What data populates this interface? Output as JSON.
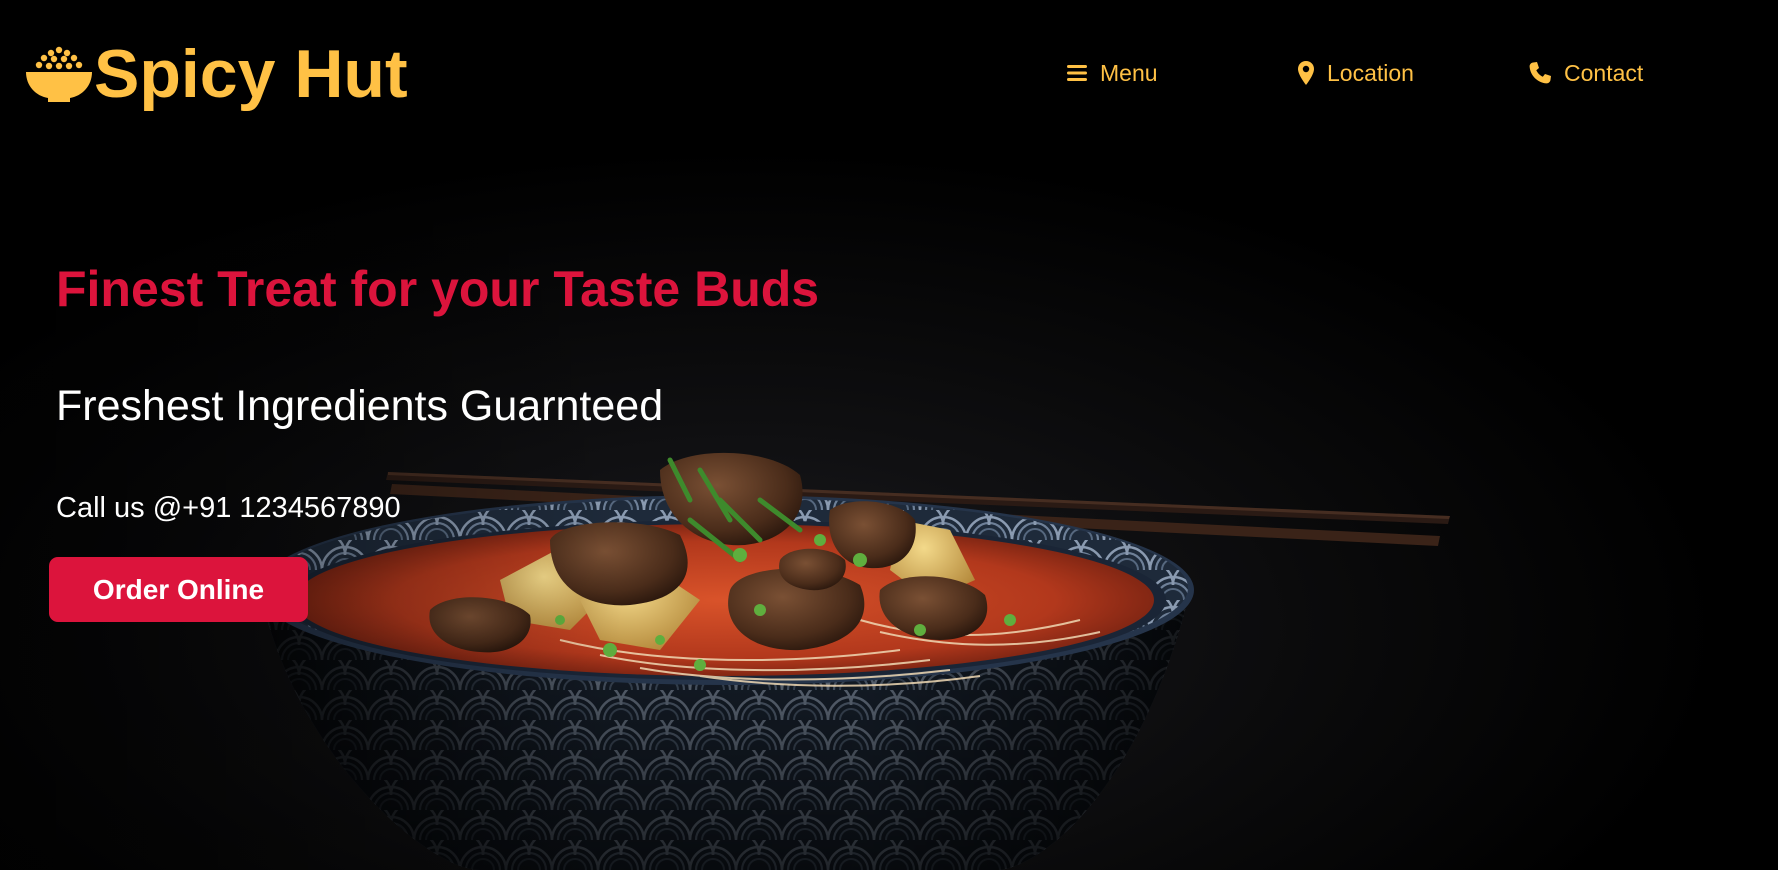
{
  "brand": {
    "name": "Spicy Hut",
    "icon": "rice-bowl-icon"
  },
  "nav": {
    "items": [
      {
        "label": "Menu",
        "icon": "bars-icon"
      },
      {
        "label": "Location",
        "icon": "map-pin-icon"
      },
      {
        "label": "Contact",
        "icon": "phone-icon"
      }
    ]
  },
  "hero": {
    "headline": "Finest Treat for your Taste Buds",
    "subheadline": "Freshest Ingredients Guarnteed",
    "call": "Call us @+91 1234567890",
    "cta_label": "Order Online"
  },
  "colors": {
    "background": "#000000",
    "brand_yellow": "#ffc145",
    "accent_red": "#dc143c",
    "text_white": "#ffffff"
  }
}
